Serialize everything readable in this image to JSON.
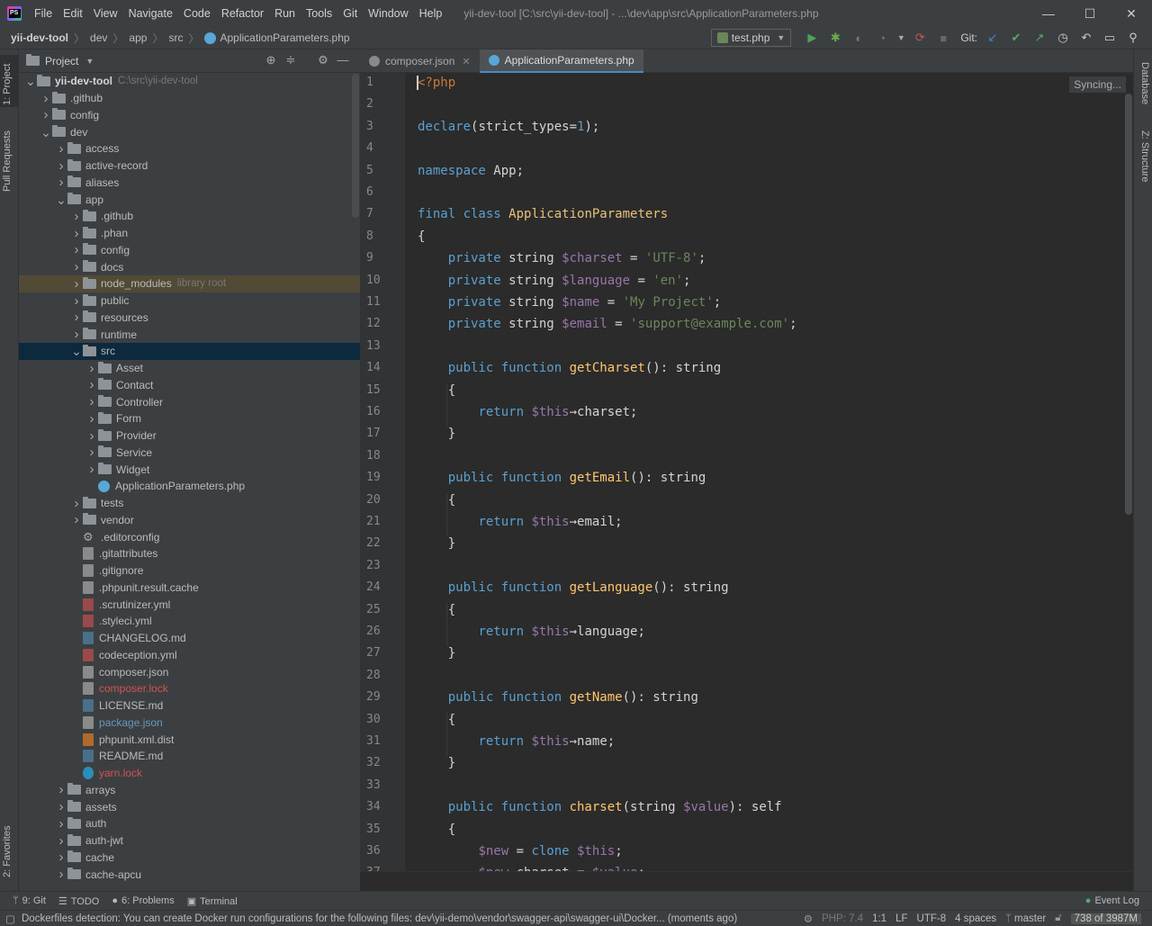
{
  "titlebar": {
    "menu": [
      "File",
      "Edit",
      "View",
      "Navigate",
      "Code",
      "Refactor",
      "Run",
      "Tools",
      "Git",
      "Window",
      "Help"
    ],
    "title": "yii-dev-tool [C:\\src\\yii-dev-tool] - ...\\dev\\app\\src\\ApplicationParameters.php",
    "controls": [
      "—",
      "☐",
      "✕"
    ]
  },
  "breadcrumb": [
    "yii-dev-tool",
    "dev",
    "app",
    "src",
    "ApplicationParameters.php"
  ],
  "toolbar": {
    "run_config": "test.php",
    "git_label": "Git:"
  },
  "left_strip": {
    "project": "1: Project",
    "pull_requests": "Pull Requests",
    "favorites": "2: Favorites"
  },
  "right_strip": {
    "database": "Database",
    "structure": "Z: Structure"
  },
  "project_panel": {
    "title": "Project",
    "tree": [
      {
        "d": 0,
        "a": "down",
        "t": "folder",
        "label": "yii-dev-tool",
        "extra": "C:\\src\\yii-dev-tool",
        "bold": true
      },
      {
        "d": 1,
        "a": "right",
        "t": "folder",
        "label": ".github"
      },
      {
        "d": 1,
        "a": "right",
        "t": "folder",
        "label": "config"
      },
      {
        "d": 1,
        "a": "down",
        "t": "folder",
        "label": "dev"
      },
      {
        "d": 2,
        "a": "right",
        "t": "folder",
        "label": "access"
      },
      {
        "d": 2,
        "a": "right",
        "t": "folder",
        "label": "active-record"
      },
      {
        "d": 2,
        "a": "right",
        "t": "folder",
        "label": "aliases"
      },
      {
        "d": 2,
        "a": "down",
        "t": "folder",
        "label": "app"
      },
      {
        "d": 3,
        "a": "right",
        "t": "folder",
        "label": ".github"
      },
      {
        "d": 3,
        "a": "right",
        "t": "folder",
        "label": ".phan"
      },
      {
        "d": 3,
        "a": "right",
        "t": "folder",
        "label": "config"
      },
      {
        "d": 3,
        "a": "right",
        "t": "folder",
        "label": "docs"
      },
      {
        "d": 3,
        "a": "right",
        "t": "folder",
        "label": "node_modules",
        "extra": "library root",
        "hl": true
      },
      {
        "d": 3,
        "a": "right",
        "t": "folder",
        "label": "public"
      },
      {
        "d": 3,
        "a": "right",
        "t": "folder",
        "label": "resources"
      },
      {
        "d": 3,
        "a": "right",
        "t": "folder",
        "label": "runtime"
      },
      {
        "d": 3,
        "a": "down",
        "t": "folder",
        "label": "src",
        "sel": true
      },
      {
        "d": 4,
        "a": "right",
        "t": "folder",
        "label": "Asset"
      },
      {
        "d": 4,
        "a": "right",
        "t": "folder",
        "label": "Contact"
      },
      {
        "d": 4,
        "a": "right",
        "t": "folder",
        "label": "Controller"
      },
      {
        "d": 4,
        "a": "right",
        "t": "folder",
        "label": "Form"
      },
      {
        "d": 4,
        "a": "right",
        "t": "folder",
        "label": "Provider"
      },
      {
        "d": 4,
        "a": "right",
        "t": "folder",
        "label": "Service"
      },
      {
        "d": 4,
        "a": "right",
        "t": "folder",
        "label": "Widget"
      },
      {
        "d": 4,
        "a": "none",
        "t": "php",
        "label": "ApplicationParameters.php"
      },
      {
        "d": 3,
        "a": "right",
        "t": "folder",
        "label": "tests"
      },
      {
        "d": 3,
        "a": "right",
        "t": "folder",
        "label": "vendor"
      },
      {
        "d": 3,
        "a": "none",
        "t": "gear",
        "label": ".editorconfig"
      },
      {
        "d": 3,
        "a": "none",
        "t": "file",
        "label": ".gitattributes"
      },
      {
        "d": 3,
        "a": "none",
        "t": "file",
        "label": ".gitignore"
      },
      {
        "d": 3,
        "a": "none",
        "t": "file",
        "label": ".phpunit.result.cache"
      },
      {
        "d": 3,
        "a": "none",
        "t": "yml",
        "label": ".scrutinizer.yml"
      },
      {
        "d": 3,
        "a": "none",
        "t": "yml",
        "label": ".styleci.yml"
      },
      {
        "d": 3,
        "a": "none",
        "t": "md",
        "label": "CHANGELOG.md"
      },
      {
        "d": 3,
        "a": "none",
        "t": "yml",
        "label": "codeception.yml"
      },
      {
        "d": 3,
        "a": "none",
        "t": "file",
        "label": "composer.json"
      },
      {
        "d": 3,
        "a": "none",
        "t": "file",
        "label": "composer.lock",
        "color": "red"
      },
      {
        "d": 3,
        "a": "none",
        "t": "md",
        "label": "LICENSE.md"
      },
      {
        "d": 3,
        "a": "none",
        "t": "file",
        "label": "package.json",
        "color": "blue"
      },
      {
        "d": 3,
        "a": "none",
        "t": "xml",
        "label": "phpunit.xml.dist"
      },
      {
        "d": 3,
        "a": "none",
        "t": "md",
        "label": "README.md"
      },
      {
        "d": 3,
        "a": "none",
        "t": "yarn",
        "label": "yarn.lock",
        "color": "red"
      },
      {
        "d": 2,
        "a": "right",
        "t": "folder",
        "label": "arrays"
      },
      {
        "d": 2,
        "a": "right",
        "t": "folder",
        "label": "assets"
      },
      {
        "d": 2,
        "a": "right",
        "t": "folder",
        "label": "auth"
      },
      {
        "d": 2,
        "a": "right",
        "t": "folder",
        "label": "auth-jwt"
      },
      {
        "d": 2,
        "a": "right",
        "t": "folder",
        "label": "cache"
      },
      {
        "d": 2,
        "a": "right",
        "t": "folder",
        "label": "cache-apcu"
      }
    ]
  },
  "editor": {
    "tabs": [
      {
        "label": "composer.json",
        "active": false
      },
      {
        "label": "ApplicationParameters.php",
        "active": true
      }
    ],
    "syncing": "Syncing...",
    "lines": [
      [
        [
          "kw",
          "<?php"
        ]
      ],
      [],
      [
        [
          "kwb",
          "declare"
        ],
        [
          "plain",
          "(strict_types="
        ],
        [
          "num",
          "1"
        ],
        [
          "plain",
          ");"
        ]
      ],
      [],
      [
        [
          "kwb",
          "namespace "
        ],
        [
          "plain",
          "App;"
        ]
      ],
      [],
      [
        [
          "kwb",
          "final class "
        ],
        [
          "cls",
          "ApplicationParameters"
        ]
      ],
      [
        [
          "plain",
          "{"
        ]
      ],
      [
        [
          "plain",
          "    "
        ],
        [
          "kwb",
          "private "
        ],
        [
          "plain",
          "string "
        ],
        [
          "var",
          "$charset"
        ],
        [
          "plain",
          " = "
        ],
        [
          "str",
          "'UTF-8'"
        ],
        [
          "plain",
          ";"
        ]
      ],
      [
        [
          "plain",
          "    "
        ],
        [
          "kwb",
          "private "
        ],
        [
          "plain",
          "string "
        ],
        [
          "var",
          "$language"
        ],
        [
          "plain",
          " = "
        ],
        [
          "str",
          "'en'"
        ],
        [
          "plain",
          ";"
        ]
      ],
      [
        [
          "plain",
          "    "
        ],
        [
          "kwb",
          "private "
        ],
        [
          "plain",
          "string "
        ],
        [
          "var",
          "$name"
        ],
        [
          "plain",
          " = "
        ],
        [
          "str",
          "'My Project'"
        ],
        [
          "plain",
          ";"
        ]
      ],
      [
        [
          "plain",
          "    "
        ],
        [
          "kwb",
          "private "
        ],
        [
          "plain",
          "string "
        ],
        [
          "var",
          "$email"
        ],
        [
          "plain",
          " = "
        ],
        [
          "str",
          "'support@example.com'"
        ],
        [
          "plain",
          ";"
        ]
      ],
      [],
      [
        [
          "plain",
          "    "
        ],
        [
          "kwb",
          "public function "
        ],
        [
          "fn",
          "getCharset"
        ],
        [
          "plain",
          "(): string"
        ]
      ],
      [
        [
          "plain",
          "    {"
        ]
      ],
      [
        [
          "plain",
          "        "
        ],
        [
          "kwb",
          "return "
        ],
        [
          "var",
          "$this"
        ],
        [
          "plain",
          "→charset;"
        ]
      ],
      [
        [
          "plain",
          "    }"
        ]
      ],
      [],
      [
        [
          "plain",
          "    "
        ],
        [
          "kwb",
          "public function "
        ],
        [
          "fn",
          "getEmail"
        ],
        [
          "plain",
          "(): string"
        ]
      ],
      [
        [
          "plain",
          "    {"
        ]
      ],
      [
        [
          "plain",
          "        "
        ],
        [
          "kwb",
          "return "
        ],
        [
          "var",
          "$this"
        ],
        [
          "plain",
          "→email;"
        ]
      ],
      [
        [
          "plain",
          "    }"
        ]
      ],
      [],
      [
        [
          "plain",
          "    "
        ],
        [
          "kwb",
          "public function "
        ],
        [
          "fn",
          "getLanguage"
        ],
        [
          "plain",
          "(): string"
        ]
      ],
      [
        [
          "plain",
          "    {"
        ]
      ],
      [
        [
          "plain",
          "        "
        ],
        [
          "kwb",
          "return "
        ],
        [
          "var",
          "$this"
        ],
        [
          "plain",
          "→language;"
        ]
      ],
      [
        [
          "plain",
          "    }"
        ]
      ],
      [],
      [
        [
          "plain",
          "    "
        ],
        [
          "kwb",
          "public function "
        ],
        [
          "fn",
          "getName"
        ],
        [
          "plain",
          "(): string"
        ]
      ],
      [
        [
          "plain",
          "    {"
        ]
      ],
      [
        [
          "plain",
          "        "
        ],
        [
          "kwb",
          "return "
        ],
        [
          "var",
          "$this"
        ],
        [
          "plain",
          "→name;"
        ]
      ],
      [
        [
          "plain",
          "    }"
        ]
      ],
      [],
      [
        [
          "plain",
          "    "
        ],
        [
          "kwb",
          "public function "
        ],
        [
          "fn",
          "charset"
        ],
        [
          "plain",
          "(string "
        ],
        [
          "var",
          "$value"
        ],
        [
          "plain",
          "): self"
        ]
      ],
      [
        [
          "plain",
          "    {"
        ]
      ],
      [
        [
          "plain",
          "        "
        ],
        [
          "var",
          "$new"
        ],
        [
          "plain",
          " = "
        ],
        [
          "kwb",
          "clone "
        ],
        [
          "var",
          "$this"
        ],
        [
          "plain",
          ";"
        ]
      ],
      [
        [
          "plain",
          "        "
        ],
        [
          "var",
          "$new"
        ],
        [
          "plain",
          "→charset = "
        ],
        [
          "var",
          "$value"
        ],
        [
          "plain",
          ";"
        ]
      ]
    ]
  },
  "tool_windows": {
    "git": "9: Git",
    "todo": "TODO",
    "problems": "6: Problems",
    "terminal": "Terminal",
    "event_log": "Event Log"
  },
  "statusbar": {
    "message": "Dockerfiles detection: You can create Docker run configurations for the following files: dev\\yii-demo\\vendor\\swagger-api\\swagger-ui\\Docker... (moments ago)",
    "php": "PHP: 7.4",
    "position": "1:1",
    "line_sep": "LF",
    "encoding": "UTF-8",
    "indent": "4 spaces",
    "branch": "master",
    "memory": "738 of 3987M"
  }
}
